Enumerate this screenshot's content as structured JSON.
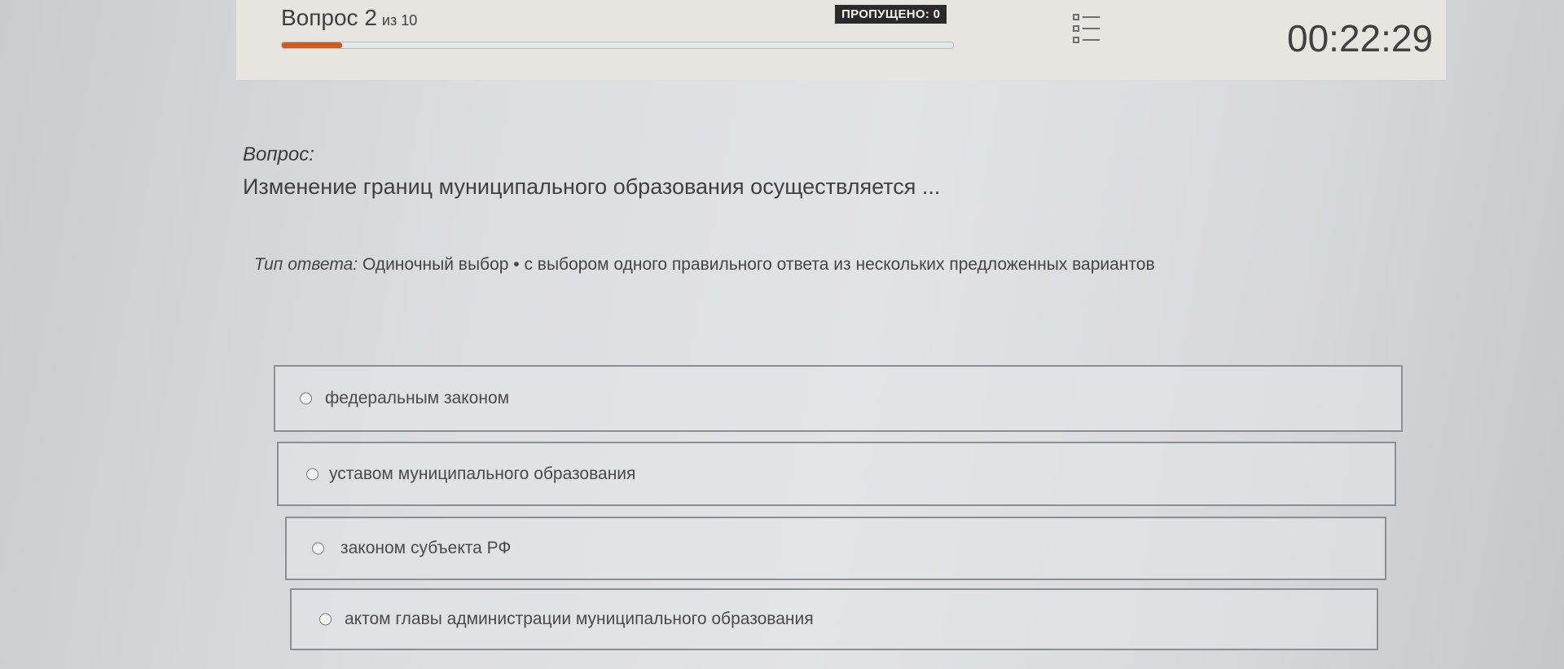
{
  "header": {
    "question_counter": "Вопрос 2",
    "question_total": "из 10",
    "progress": 0.09,
    "progress_color": "#d35a1f",
    "skipped_badge": "ПРОПУЩЕНО: 0",
    "list_icon": "question-list-icon",
    "timer": "00:22:29"
  },
  "question": {
    "label": "Вопрос:",
    "text": "Изменение границ муниципального образования осуществляется ...",
    "answer_type_label": "Тип ответа:",
    "answer_type_value": "Одиночный выбор • с выбором одного правильного ответа из нескольких предложенных вариантов"
  },
  "options": [
    {
      "label": "федеральным законом",
      "selected": false
    },
    {
      "label": "уставом муниципального образования",
      "selected": false
    },
    {
      "label": "законом субъекта РФ",
      "selected": false
    },
    {
      "label": "актом главы администрации муниципального образования",
      "selected": false
    }
  ]
}
